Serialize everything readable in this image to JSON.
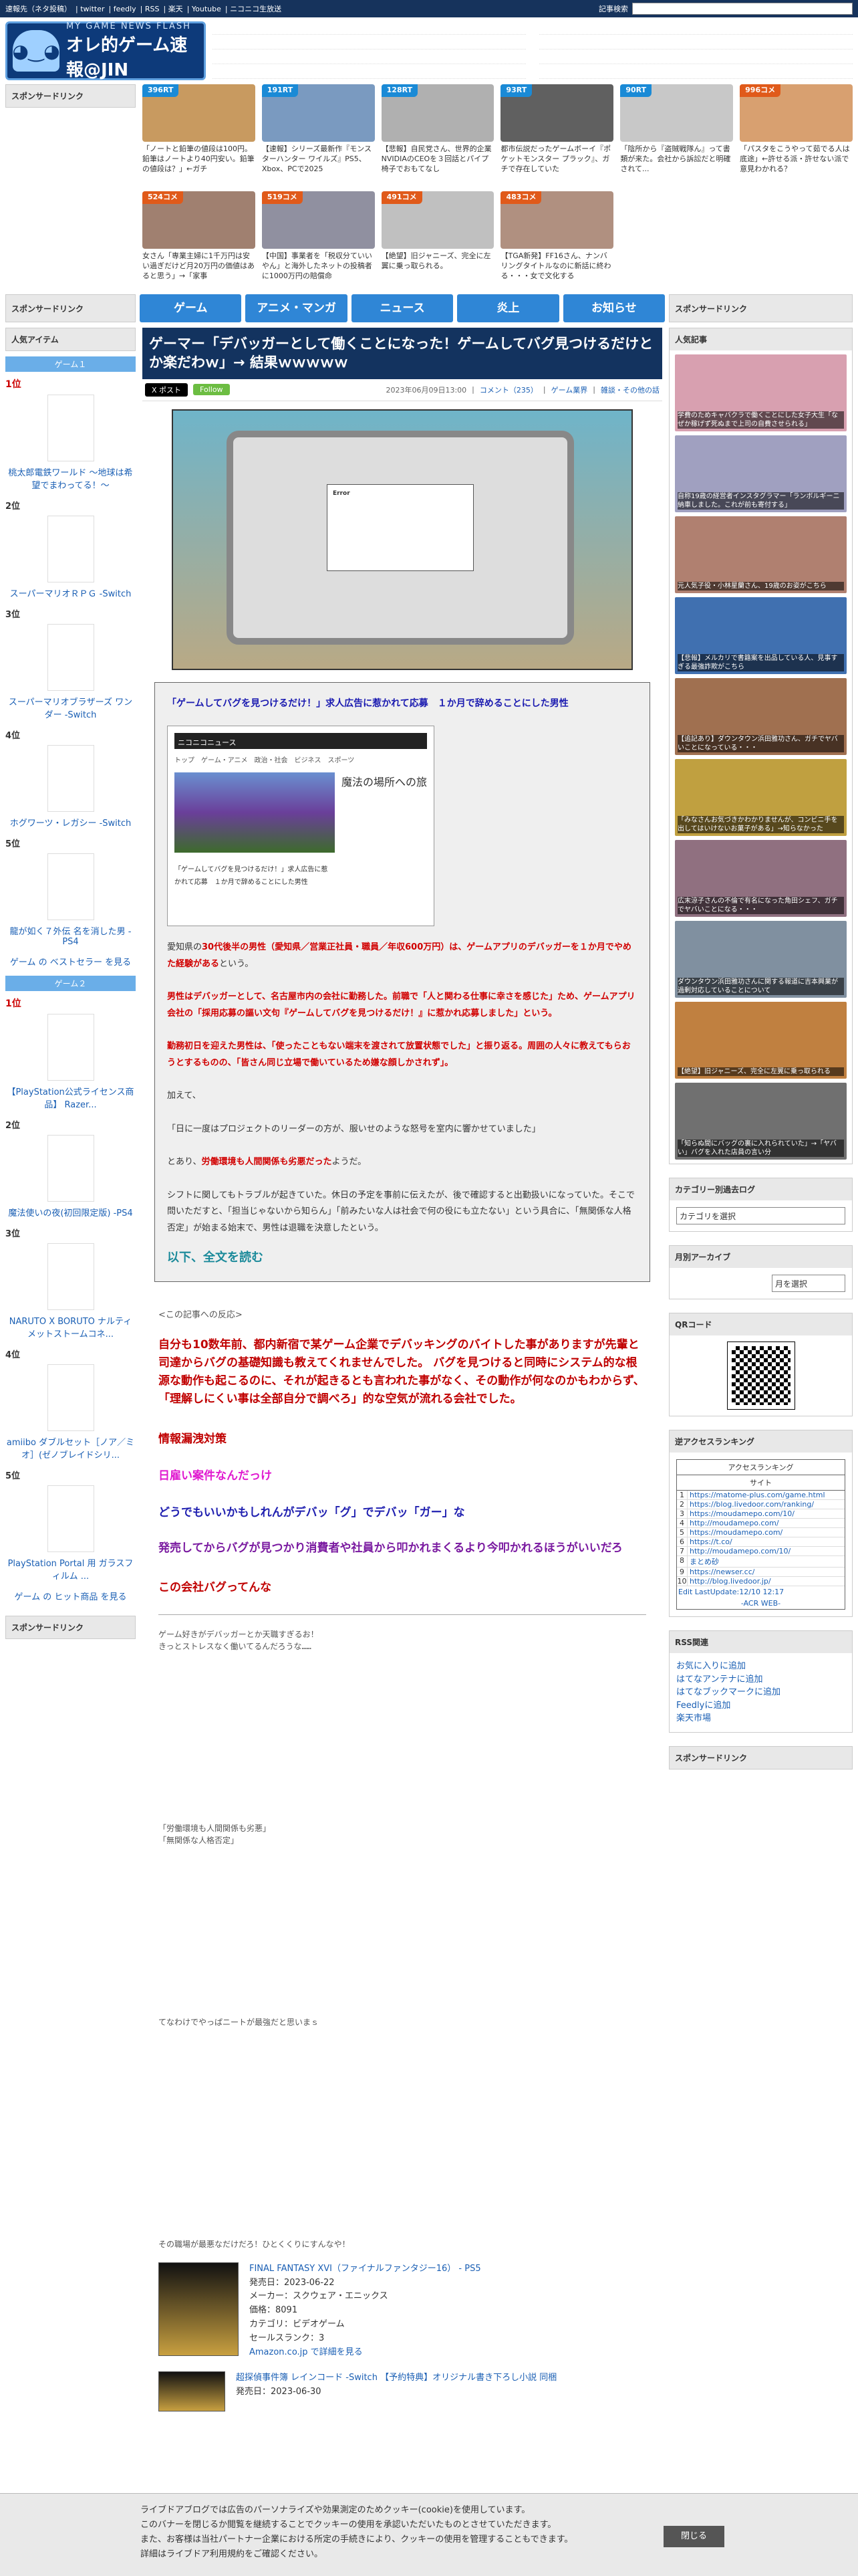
{
  "topbar": {
    "links": [
      "速報先（ネタ投稿）",
      "twitter",
      "feedly",
      "RSS",
      "楽天",
      "Youtube",
      "ニコニコ生放送"
    ],
    "search_label": "記事検索"
  },
  "logo": {
    "line1": "MY GAME NEWS FLASH",
    "line2": "オレ的ゲーム速報@JIN"
  },
  "sidebar_ad": "スポンサードリンク",
  "thumbs": [
    {
      "badge": "396RT",
      "text": "「ノートと鉛筆の値段は100円。鉛筆はノートより40円安い。鉛筆の値段は？」←ガチ",
      "color": "#1a8ad6"
    },
    {
      "badge": "191RT",
      "text": "【速報】シリーズ最新作『モンスターハンター ワイルズ』PS5、Xbox、PCで2025",
      "color": "#1a8ad6"
    },
    {
      "badge": "128RT",
      "text": "【悲報】自民党さん、世界的企業NVIDIAのCEOを３回話とパイプ椅子でおもてなし",
      "color": "#1a8ad6"
    },
    {
      "badge": "93RT",
      "text": "都市伝説だったゲームボーイ『ポケットモンスター プラック』、ガチで存在していた",
      "color": "#1a8ad6"
    },
    {
      "badge": "90RT",
      "text": "「陰所から『盗賊戦隊ん』って書類が来た。会社から訴訟だと明確されて...",
      "color": "#1a8ad6"
    },
    {
      "badge": "996コメ",
      "text": "「パスタをこうやって茹でる人は底途」←許せる派・許せない派で意見わかれる？",
      "color": "#e05a1a"
    },
    {
      "badge": "524コメ",
      "text": "女さん「専業主婦に1千万円は安い過ぎだけど月20万円の価値はあると思う」→「家事",
      "color": "#e05a1a"
    },
    {
      "badge": "519コメ",
      "text": "【中国】事業者を「税収分ていいやん」と海外したネットの投稿者に1000万円の賠償命",
      "color": "#e05a1a"
    },
    {
      "badge": "491コメ",
      "text": "【絶望】旧ジャニーズ、完全に左翼に乗っ取られる。",
      "color": "#e05a1a"
    },
    {
      "badge": "483コメ",
      "text": "【TGA新発】FF16さん、ナンバリングタイトルなのに新話に終わる・・・女で文化する",
      "color": "#e05a1a"
    }
  ],
  "nav": {
    "left": "スポンサードリンク",
    "items": [
      "ゲーム",
      "アニメ・マンガ",
      "ニュース",
      "炎上",
      "お知らせ"
    ],
    "right": "スポンサードリンク"
  },
  "left": {
    "popular": "人気アイテム",
    "group1": "ゲーム１",
    "items1": [
      {
        "rank": "1位",
        "name": "桃太郎電鉄ワールド ～地球は希望でまわってる！～"
      },
      {
        "rank": "2位",
        "name": "スーパーマリオＲＰＧ -Switch"
      },
      {
        "rank": "3位",
        "name": "スーパーマリオブラザーズ ワンダー -Switch"
      },
      {
        "rank": "4位",
        "name": "ホグワーツ・レガシー -Switch"
      },
      {
        "rank": "5位",
        "name": "龍が如く７外伝 名を消した男 - PS4"
      }
    ],
    "more1": "ゲーム の ベストセラー を見る",
    "group2": "ゲーム２",
    "items2": [
      {
        "rank": "1位",
        "name": "【PlayStation公式ライセンス商品】 Razer..."
      },
      {
        "rank": "2位",
        "name": "魔法使いの夜(初回限定版) -PS4"
      },
      {
        "rank": "3位",
        "name": "NARUTO X BORUTO ナルティメットストームコネ..."
      },
      {
        "rank": "4位",
        "name": "amiibo ダブルセット［ノア／ミオ］(ゼノブレイドシリ..."
      },
      {
        "rank": "5位",
        "name": "PlayStation Portal 用 ガラスフィルム ..."
      }
    ],
    "more2": "ゲーム の ヒット商品 を見る",
    "ad2": "スポンサードリンク"
  },
  "article": {
    "title": "ゲーマー「デバッガーとして働くことになった！ゲームしてバグ見つけるだけとか楽だわｗ」→ 結果ｗｗｗｗｗ",
    "x_btn": "X ポスト",
    "follow_btn": "Follow",
    "date": "2023年06月09日13:00",
    "comment": "コメント（235）",
    "category": "ゲーム業界",
    "tags": "雑談・その他の話",
    "dialog": "Error",
    "quote_title": "「ゲームしてバグを見つけるだけ！」求人広告に惹かれて応募　１か月で辞めることにした男性",
    "nico_site": "ニコニコニュース",
    "nico_tabs": "トップ　ゲーム・アニメ　政治・社会　ビジネス　スポーツ",
    "nico_caption": "魔法の場所への旅",
    "nico_sub": "「ゲームしてバグを見つけるだけ！」求人広告に惹かれて応募　１か月で辞めることにした男性",
    "p1a": "愛知県の",
    "p1b": "30代後半の男性（愛知県／営業正社員・職員／年収600万円）は、ゲームアプリのデバッガーを１か月でやめた経験がある",
    "p1c": "という。",
    "p2": "男性はデバッガーとして、名古屋市内の会社に勤務した。前職で「人と関わる仕事に幸さを感じた」ため、ゲームアプリ会社の「採用応募の謳い文句『ゲームしてバグを見つけるだけ！』に惹かれ応募しました」という。",
    "p3": "勤務初日を迎えた男性は、「使ったこともない端末を渡されて放置状態でした」と振り返る。周囲の人々に教えてもらおうとするものの、「皆さん同じ立場で働いているため嫌な顔しかされず」。",
    "p4": "加えて、",
    "p5": "「日に一度はプロジェクトのリーダーの方が、服いせのような怒号を室内に響かせていました」",
    "p6a": "とあり、",
    "p6b": "労働環境も人間関係も劣悪だった",
    "p6c": "ようだ。",
    "p7": "シフトに関してもトラブルが起きていた。休日の予定を事前に伝えたが、後で確認すると出勤扱いになっていた。そこで問いただすと、「担当じゃないから知らん」「前みたいな人は社会で何の役にも立たない」という具合に、「無関係な人格否定」が始まる始末で、男性は退職を決意したという。",
    "readmore": "以下、全文を読む",
    "reaction_lead": "<この記事への反応>",
    "r1": "自分も10数年前、都内新宿で某ゲーム企業でデバッキングのバイトした事がありますが先輩と司達からバグの基礎知識も教えてくれませんでした。 バグを見つけると同時にシステム的な根源な動作も起こるのに、それが起きるとも言われた事がなく、その動作が何なのかもわからず、「理解しにくい事は全部自分で調べろ」的な空気が流れる会社でした。",
    "r2": "情報漏洩対策",
    "r3": "日雇い案件なんだっけ",
    "r4": "どうでもいいかもしれんがデバッ「グ」でデバッ「ガー」な",
    "r5": "発売してからバグが見つかり消費者や社員から叩かれまくるより今叩かれるほうがいいだろ",
    "r6": "この会社バグってんな",
    "aa1_lead": "ゲーム好きがデバッガーとか天職すぎるお！\nきっとストレスなく働いてるんだろうな……",
    "aa2_lead": "「労働環境も人間関係も劣悪」\n「無関係な人格否定」",
    "aa3_lead": "てなわけでやっぱニートが最強だと思いまｓ",
    "aa4_lead": "その職場が最悪なだけだろ！ひとくくりにすんなや！",
    "prod1": {
      "name": "FINAL FANTASY XVI（ファイナルファンタジー16） - PS5",
      "date": "発売日：2023-06-22",
      "maker": "メーカー：スクウェア・エニックス",
      "price": "価格：8091",
      "cat": "カテゴリ：ビデオゲーム",
      "rank": "セールスランク：3",
      "link": "Amazon.co.jp で詳細を見る"
    },
    "prod2": {
      "name": "超探偵事件簿 レインコード -Switch 【予約特典】オリジナル書き下ろし小説 同梱",
      "date": "発売日：2023-06-30"
    }
  },
  "right": {
    "popular": "人気記事",
    "ranks": [
      "学費のためキャバクラで働くことにした女子大生「なぜか稼げず死ぬまで上司の自費させられる」",
      "自称19歳の経営者インスタグラマー「ランボルギーニ納車しました。これが前も寄付する」",
      "元人気子役・小林星蘭さん、19歳のお姿がこちら",
      "【悲報】メルカリで書籍案を出品している人、見事すぎる最強詐欺がこちら",
      "【追記あり】ダウンタウン浜田雅功さん、ガチでヤバいことになっている・・・",
      "「みなさんお気づきかわかりませんが、コンビニ手を出してはいけないお菓子がある」→知らなかった",
      "広末涼子さんの不倫で有名になった角田シェフ、ガチでヤバいことになる・・・",
      "ダウンタウン浜田雅功さんに関する報道に吉本興業が過剰対応していることについて",
      "【絶望】旧ジャニーズ、完全に左翼に乗っ取られる",
      "「知らぬ間にバッグの裏に入れられていた」→「ヤバい」バグを入れた店員の言い分"
    ],
    "cat_h": "カテゴリー別過去ログ",
    "cat_sel": "カテゴリを選択",
    "month_h": "月別アーカイブ",
    "month_sel": "月を選択",
    "qr_h": "QRコード",
    "acc_h": "逆アクセスランキング",
    "acc_title": "アクセスランキング",
    "acc_sub": "サイト",
    "acc_rows": [
      "https://matome-plus.com/game.html",
      "https://blog.livedoor.com/ranking/",
      "https://moudamepo.com/10/",
      "http://moudamepo.com/",
      "https://moudamepo.com/",
      "https://t.co/",
      "http://moudamepo.com/10/",
      "まとめ砂",
      "https://newser.cc/",
      "http://blog.livedoor.jp/"
    ],
    "acc_edit": "Edit LastUpdate:12/10 12:17",
    "acc_foot": "-ACR WEB-",
    "rss_h": "RSS関連",
    "rss": [
      "お気に入りに追加",
      "はてなアンテナに追加",
      "はてなブックマークに追加",
      "Feedlyに追加",
      "楽天市場"
    ],
    "ad3": "スポンサードリンク"
  },
  "cookie": {
    "l1": "ライブドアブログでは広告のパーソナライズや効果測定のためクッキー(cookie)を使用しています。",
    "l2": "このバナーを閉じるか閲覧を継続することでクッキーの使用を承認いただいたものとさせていただきます。",
    "l3": "また、お客様は当社パートナー企業における所定の手続きにより、クッキーの使用を管理することもできます。",
    "l4": "詳細はライブドア利用規約をご確認ください。",
    "close": "閉じる"
  }
}
